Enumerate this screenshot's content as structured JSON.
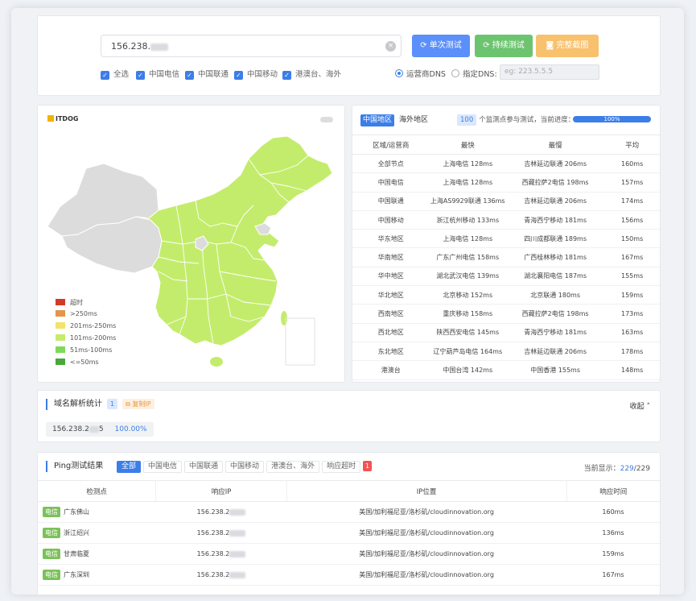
{
  "top": {
    "ip_value": "156.238.",
    "buttons": {
      "single": "单次测试",
      "continuous": "持续测试",
      "screenshot": "完整截图"
    },
    "checks": [
      "全选",
      "中国电信",
      "中国联通",
      "中国移动",
      "港澳台、海外"
    ],
    "dns_isp": "运营商DNS",
    "dns_custom": "指定DNS:",
    "dns_placeholder": "eg: 223.5.5.5"
  },
  "map": {
    "logo": "ITDOG",
    "legend": [
      {
        "label": "超时",
        "color": "#d43a2a"
      },
      {
        "label": ">250ms",
        "color": "#e4954a"
      },
      {
        "label": "201ms-250ms",
        "color": "#f2e46a"
      },
      {
        "label": "101ms-200ms",
        "color": "#c4ec6c"
      },
      {
        "label": "51ms-100ms",
        "color": "#7fd95a"
      },
      {
        "label": "<=50ms",
        "color": "#4aa83a"
      }
    ],
    "colors": {
      "china": "#c4ec6c",
      "other": "#dcdcdc"
    }
  },
  "stats": {
    "tabs": [
      "中国地区",
      "海外地区"
    ],
    "count": "100",
    "count_text": "个监测点参与测试，当前进度：",
    "progress": "100%",
    "headers": [
      "区域/运营商",
      "最快",
      "最慢",
      "平均"
    ],
    "rows": [
      [
        "全部节点",
        "上海电信 128ms",
        "吉林延边联通 206ms",
        "160ms"
      ],
      [
        "中国电信",
        "上海电信 128ms",
        "西藏拉萨2电信 198ms",
        "157ms"
      ],
      [
        "中国联通",
        "上海AS9929联通 136ms",
        "吉林延边联通 206ms",
        "174ms"
      ],
      [
        "中国移动",
        "浙江杭州移动 133ms",
        "青海西宁移动 181ms",
        "156ms"
      ],
      [
        "华东地区",
        "上海电信 128ms",
        "四川成都联通 189ms",
        "150ms"
      ],
      [
        "华南地区",
        "广东广州电信 158ms",
        "广西桂林移动 181ms",
        "167ms"
      ],
      [
        "华中地区",
        "湖北武汉电信 139ms",
        "湖北襄阳电信 187ms",
        "155ms"
      ],
      [
        "华北地区",
        "北京移动 152ms",
        "北京联通 180ms",
        "159ms"
      ],
      [
        "西南地区",
        "重庆移动 158ms",
        "西藏拉萨2电信 198ms",
        "173ms"
      ],
      [
        "西北地区",
        "陕西西安电信 145ms",
        "青海西宁移动 181ms",
        "163ms"
      ],
      [
        "东北地区",
        "辽宁葫芦岛电信 164ms",
        "吉林延边联通 206ms",
        "178ms"
      ],
      [
        "港澳台",
        "中国台湾 142ms",
        "中国香港 155ms",
        "148ms"
      ]
    ]
  },
  "domain": {
    "title": "域名解析统计",
    "count": "1",
    "copy": "复制IP",
    "fold": "收起",
    "ip_prefix": "156.238.2",
    "ip_suffix": "5",
    "percent": "100.00%"
  },
  "ping": {
    "title": "Ping测试结果",
    "tabs": [
      "全部",
      "中国电信",
      "中国联通",
      "中国移动",
      "港澳台、海外",
      "响应超时"
    ],
    "timeout_count": "1",
    "shown_label": "当前显示：",
    "shown": "229",
    "total": "/229",
    "headers": [
      "检测点",
      "响应IP",
      "IP位置",
      "响应时间"
    ],
    "rows": [
      {
        "isp": "电信",
        "loc": "广东佛山",
        "ip": "156.238.2",
        "geo": "美国/加利福尼亚/洛杉矶/cloudinnovation.org",
        "time": "160ms"
      },
      {
        "isp": "电信",
        "loc": "浙江绍兴",
        "ip": "156.238.2",
        "geo": "美国/加利福尼亚/洛杉矶/cloudinnovation.org",
        "time": "136ms"
      },
      {
        "isp": "电信",
        "loc": "甘肃临夏",
        "ip": "156.238.2",
        "geo": "美国/加利福尼亚/洛杉矶/cloudinnovation.org",
        "time": "159ms"
      },
      {
        "isp": "电信",
        "loc": "广东深圳",
        "ip": "156.238.2",
        "geo": "美国/加利福尼亚/洛杉矶/cloudinnovation.org",
        "time": "167ms"
      }
    ]
  }
}
